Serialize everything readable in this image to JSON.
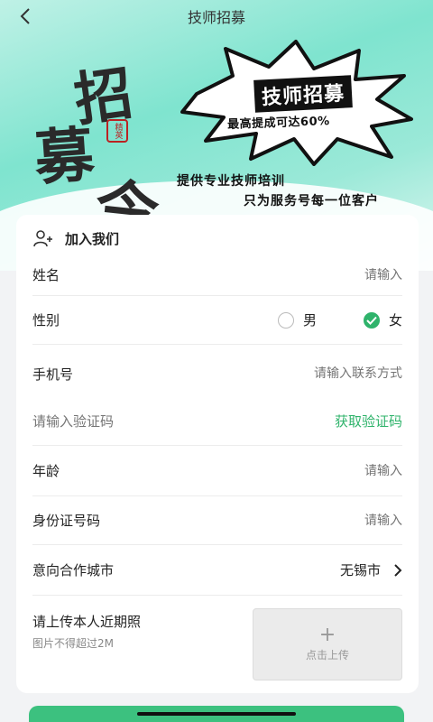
{
  "nav": {
    "title": "技师招募"
  },
  "banner": {
    "calligraphy": [
      "招",
      "募",
      "令"
    ],
    "seal": "精英",
    "headline": "技师招募",
    "subline": "最高提成可达60%",
    "slogan_1": "提供专业技师培训",
    "slogan_2": "只为服务号每一位客户"
  },
  "form": {
    "section_title": "加入我们",
    "name": {
      "label": "姓名",
      "placeholder": "请输入"
    },
    "gender": {
      "label": "性别",
      "options": [
        {
          "label": "男",
          "checked": false
        },
        {
          "label": "女",
          "checked": true
        }
      ]
    },
    "phone": {
      "label": "手机号",
      "placeholder": "请输入联系方式"
    },
    "code": {
      "placeholder": "请输入验证码",
      "action": "获取验证码"
    },
    "age": {
      "label": "年龄",
      "placeholder": "请输入"
    },
    "id_number": {
      "label": "身份证号码",
      "placeholder": "请输入"
    },
    "city": {
      "label": "意向合作城市",
      "value": "无锡市"
    },
    "photo": {
      "title": "请上传本人近期照",
      "hint": "图片不得超过2M",
      "button": "点击上传"
    }
  },
  "colors": {
    "accent": "#2fb36b",
    "hero": "#7fe4cf"
  }
}
